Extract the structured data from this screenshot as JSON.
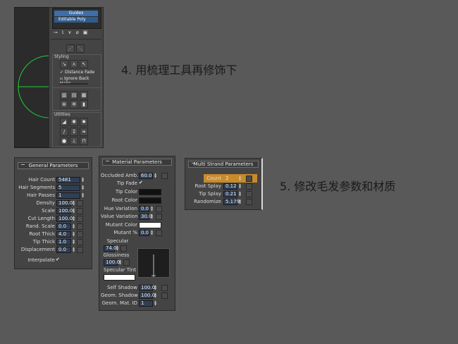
{
  "captions": {
    "step4": "4. 用梳理工具再修饰下",
    "step5": "5. 修改毛发参数和材质"
  },
  "topPanel": {
    "stackItems": [
      "Guides",
      "Editable Poly"
    ],
    "stylingTitle": "Styling",
    "distanceFade": "Distance Fade",
    "ignoreBackHairs": "Ignore Back Hairs",
    "utilitiesTitle": "Utilities"
  },
  "general": {
    "title": "General Parameters",
    "rows": [
      {
        "label": "Hair Count",
        "value": "5481"
      },
      {
        "label": "Hair Segments",
        "value": "5"
      },
      {
        "label": "Hair Passes",
        "value": "1"
      },
      {
        "label": "Density",
        "value": "100.0"
      },
      {
        "label": "Scale",
        "value": "100.0"
      },
      {
        "label": "Cut Length",
        "value": "100.0"
      },
      {
        "label": "Rand. Scale",
        "value": "0.0"
      },
      {
        "label": "Root Thick",
        "value": "4.0"
      },
      {
        "label": "Tip Thick",
        "value": "1.0"
      },
      {
        "label": "Displacement",
        "value": "0.0"
      }
    ],
    "interpolate": "Interpolate"
  },
  "material": {
    "title": "Material Parameters",
    "occluded": {
      "label": "Occluded Amb.",
      "value": "60.0"
    },
    "tipFade": "Tip Fade",
    "tipColor": "Tip Color",
    "rootColor": "Root Color",
    "hueVariation": {
      "label": "Hue Variation",
      "value": "0.0"
    },
    "valueVariation": {
      "label": "Value Variation",
      "value": "30.0"
    },
    "mutantColor": "Mutant Color",
    "mutantPct": {
      "label": "Mutant %",
      "value": "0.0"
    },
    "specular": {
      "label": "Specular",
      "value": "74.0"
    },
    "glossiness": {
      "label": "Glossiness",
      "value": "100.0"
    },
    "specularTint": "Specular Tint",
    "selfShadow": {
      "label": "Self Shadow",
      "value": "100.0"
    },
    "geomShadow": {
      "label": "Geom. Shadow",
      "value": "100.0"
    },
    "geomMatId": {
      "label": "Geom. Mat. ID",
      "value": "1"
    },
    "colors": {
      "tip": "#111111",
      "root": "#111111",
      "mutant": "#ffffff",
      "specTint": "#ffffff"
    }
  },
  "multi": {
    "title": "Multi Strand Parameters",
    "rows": [
      {
        "label": "Count",
        "value": "2"
      },
      {
        "label": "Root Splay",
        "value": "0.12"
      },
      {
        "label": "Tip Splay",
        "value": "0.21"
      },
      {
        "label": "Randomize",
        "value": "5.179"
      }
    ],
    "highlight": "#c98a2a"
  }
}
